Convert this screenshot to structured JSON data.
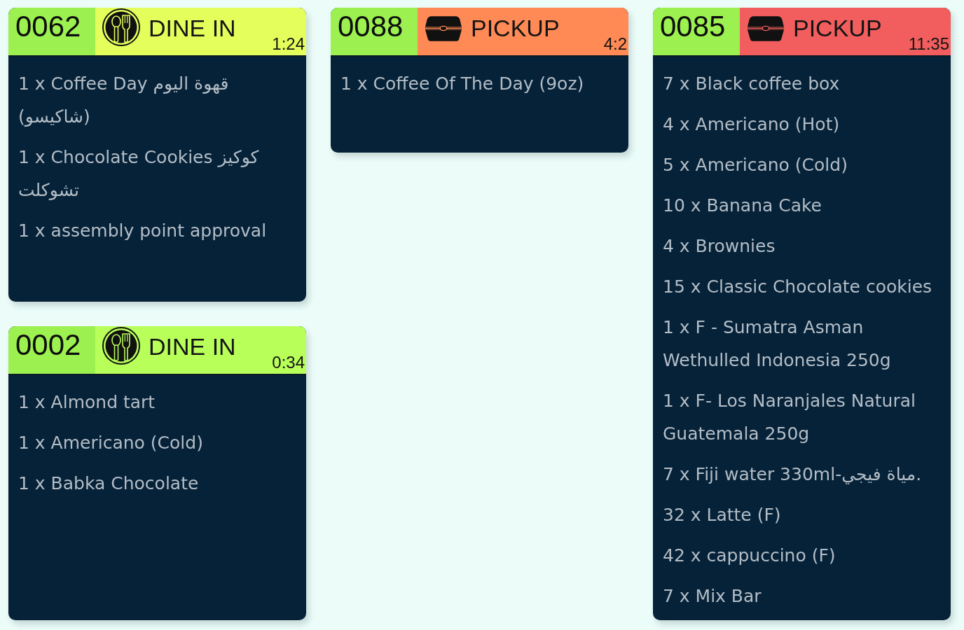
{
  "columns": [
    {
      "tickets": [
        {
          "number": "0062",
          "kind": "dine_in",
          "order_type": "DINE IN",
          "timer": "1:24",
          "color": "#e4ff5c",
          "items": [
            "1 x Coffee Day قهوة اليوم (شاكيسو)",
            "1 x Chocolate Cookies كوكيز تشوكلت",
            "1 x assembly point approval"
          ]
        },
        {
          "number": "0002",
          "kind": "dine_in",
          "order_type": "DINE IN",
          "timer": "0:34",
          "color": "#b8ff5a",
          "items": [
            "1 x Almond tart",
            "1 x Americano (Cold)",
            "1 x Babka Chocolate"
          ]
        }
      ]
    },
    {
      "tickets": [
        {
          "number": "0088",
          "kind": "pickup",
          "order_type": "PICKUP",
          "timer": "4:2",
          "color": "#ff8a55",
          "items": [
            "1 x Coffee Of The Day (9oz)"
          ]
        }
      ]
    },
    {
      "tickets": [
        {
          "number": "0085",
          "kind": "pickup",
          "order_type": "PICKUP",
          "timer": "11:35",
          "color": "#f25e5e",
          "items": [
            "7 x Black coffee box",
            "4 x Americano (Hot)",
            "5 x Americano (Cold)",
            "10 x Banana Cake",
            "4 x Brownies",
            "15 x Classic Chocolate cookies",
            "1 x F - Sumatra Asman Wethulled Indonesia 250g",
            "1 x F- Los Naranjales Natural Guatemala 250g",
            "7 x Fiji water 330ml-مياة فيجي.",
            "32 x Latte (F)",
            "42 x cappuccino (F)",
            "7 x Mix Bar"
          ]
        }
      ]
    }
  ]
}
